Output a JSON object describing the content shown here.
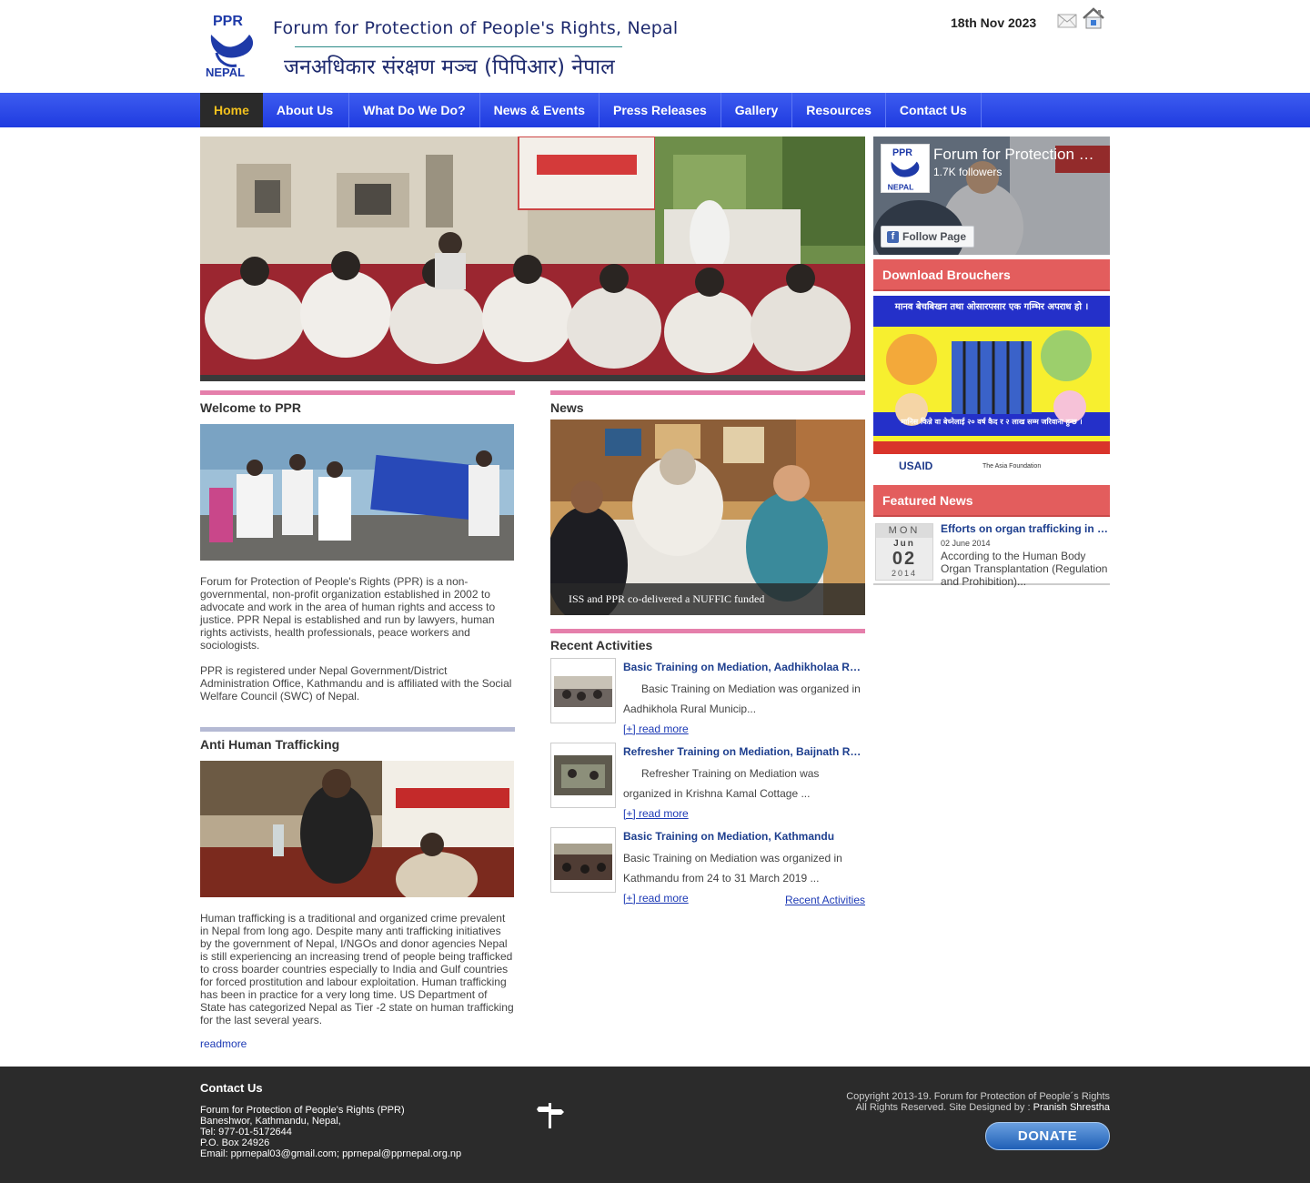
{
  "header": {
    "logo_text_top": "PPR",
    "logo_text_bottom": "NEPAL",
    "title_en": "Forum for Protection of People's Rights, Nepal",
    "title_np": "जनअधिकार संरक्षण मञ्च (पिपिआर) नेपाल",
    "date": "18th Nov 2023"
  },
  "nav": {
    "items": [
      "Home",
      "About Us",
      "What Do We Do?",
      "News & Events",
      "Press Releases",
      "Gallery",
      "Resources",
      "Contact Us"
    ]
  },
  "welcome": {
    "title": "Welcome to PPR",
    "para1": "Forum for Protection of People's Rights (PPR) is a non-governmental, non-profit organization established in 2002 to advocate and work in the area of human rights and access to justice. PPR Nepal is established and run by lawyers, human rights activists, health professionals, peace workers and sociologists.",
    "para2": "PPR is registered under Nepal Government/District Administration Office, Kathmandu and is affiliated with the Social Welfare Council (SWC) of Nepal."
  },
  "trafficking": {
    "title": "Anti Human Trafficking",
    "text": "Human trafficking is a traditional and organized crime prevalent in Nepal from long ago. Despite many anti trafficking initiatives by the government of Nepal, I/NGOs and donor agencies Nepal is still experiencing an increasing trend of people being trafficked to cross boarder countries especially to India and Gulf countries for forced prostitution and labour exploitation. Human trafficking has been in practice for a very long time. US Department of State has categorized Nepal as Tier -2 state on human trafficking for the last several years.",
    "readmore": "readmore"
  },
  "news": {
    "title": "News",
    "caption": "ISS and PPR co-delivered a NUFFIC funded"
  },
  "activities": {
    "title": "Recent Activities",
    "items": [
      {
        "title": "Basic Training on Mediation, Aadhikholaa Rural Municipality",
        "desc": "Basic Training on Mediation was organized in Aadhikhola Rural Municip...",
        "link": "[+] read more"
      },
      {
        "title": "Refresher Training on Mediation, Baijnath Rural Municipality",
        "desc": "Refresher Training on Mediation was organized in Krishna Kamal Cottage ...",
        "link": "[+] read more"
      },
      {
        "title": "Basic Training on Mediation, Kathmandu",
        "desc": "Basic Training on Mediation was organized in Kathmandu from 24 to 31 March 2019 ...",
        "link": "[+] read more"
      }
    ],
    "all_link": "Recent Activities"
  },
  "sidebar": {
    "fb_name": "Forum for Protection of People's Rights",
    "fb_followers": "1.7K followers",
    "fb_follow": "Follow Page",
    "download_title": "Download Brouchers",
    "poster_headline": "मानव बेचबिखन तथा ओसारपसार एक गम्भिर अपराध हो ।",
    "poster_sub": "मानिस किन्ने वा बेच्नेलाई २० वर्ष कैद र २ लाख सम्म जरिवाना हुन्छ ।",
    "poster_logo1": "USAID",
    "poster_logo2": "The Asia Foundation",
    "featured_title": "Featured News",
    "featured": {
      "dow": "MON",
      "month": "Jun",
      "day": "02",
      "year": "2014",
      "title": "Efforts on organ trafficking in Nepal",
      "date": "02 June 2014",
      "excerpt": "According to the Human Body Organ Transplantation (Regulation and Prohibition)..."
    }
  },
  "footer": {
    "contact_title": "Contact Us",
    "contact_lines": [
      "Forum for Protection of People's Rights (PPR)",
      "Baneshwor, Kathmandu, Nepal,",
      "Tel: 977-01-5172644",
      "P.O. Box 24926",
      "Email: pprnepal03@gmail.com; pprnepal@pprnepal.org.np"
    ],
    "copyright": "Copyright 2013-19. Forum for Protection of People´s Rights",
    "rights": "All Rights Reserved. Site Designed by : ",
    "designer": "Pranish Shrestha",
    "donate": "DONATE"
  },
  "colors": {
    "nav_blue": "#2846e6",
    "accent_pink": "#e57fab",
    "sidebar_red": "#e35d5d",
    "link_blue": "#1d3e8e",
    "footer_bg": "#2b2b2b"
  }
}
